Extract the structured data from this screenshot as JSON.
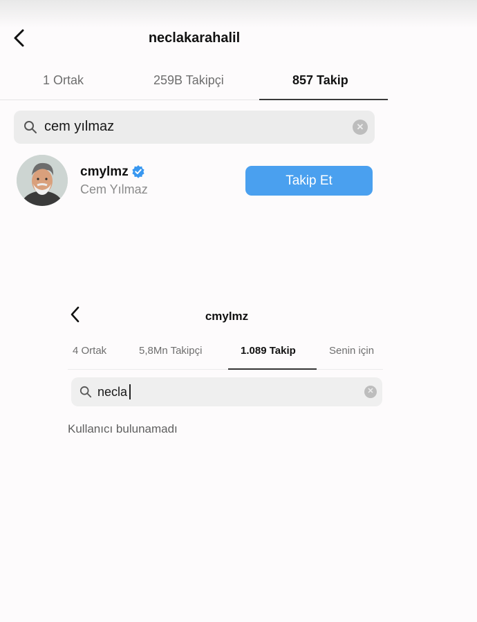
{
  "panel1": {
    "title": "neclakarahalil",
    "tabs": [
      {
        "label": "1 Ortak",
        "active": false
      },
      {
        "label": "259B Takipçi",
        "active": false
      },
      {
        "label": "857 Takip",
        "active": true
      }
    ],
    "search": {
      "value": "cem yılmaz",
      "icon": "search-icon",
      "clear_icon": "clear-icon"
    },
    "result": {
      "username": "cmylmz",
      "full_name": "Cem Yılmaz",
      "verified": true,
      "follow_button": "Takip Et"
    }
  },
  "panel2": {
    "title": "cmylmz",
    "tabs": [
      {
        "label": "4 Ortak",
        "active": false
      },
      {
        "label": "5,8Mn Takipçi",
        "active": false
      },
      {
        "label": "1.089 Takip",
        "active": true
      },
      {
        "label": "Senin için",
        "active": false
      }
    ],
    "search": {
      "value": "necla",
      "icon": "search-icon",
      "clear_icon": "clear-icon"
    },
    "empty_message": "Kullanıcı bulunamadı"
  },
  "colors": {
    "accent_button": "#4aa0ef",
    "verified_badge": "#3897f0",
    "search_bg": "#ececec"
  }
}
